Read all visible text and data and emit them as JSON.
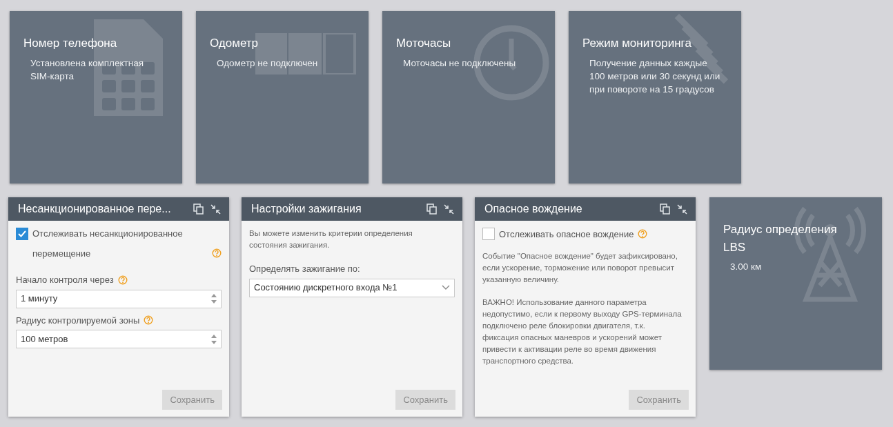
{
  "top_tiles": [
    {
      "kind": "sim",
      "title": "Номер телефона",
      "text": "Установлена комплектная SIM-карта"
    },
    {
      "kind": "odometer",
      "title": "Одометр",
      "text": "Одометр не подключен"
    },
    {
      "kind": "clock",
      "title": "Моточасы",
      "text": "Моточасы не подключены"
    },
    {
      "kind": "signal",
      "title": "Режим мониторинга",
      "text": "Получение данных каждые 100 метров или 30 секунд или при повороте на 15 градусов"
    }
  ],
  "panels": [
    {
      "title": "Несанкционированное пере...",
      "items": [
        {
          "kind": "checkbox",
          "label": "Отслеживать несанкционированное перемещение",
          "checked": true,
          "help": true
        },
        {
          "kind": "number_field",
          "label": "Начало контроля через",
          "value": "1  минуту",
          "help": true
        },
        {
          "kind": "number_field",
          "label": "Радиус контролируемой зоны",
          "value": "100  метров",
          "help": true
        }
      ],
      "button": {
        "label": "Сохранить",
        "disabled": true
      }
    },
    {
      "title": "Настройки зажигания",
      "items": [
        {
          "kind": "note",
          "text": "Вы можете изменить критерии определения состояния зажигания."
        },
        {
          "kind": "select",
          "label": "Определять зажигание по:",
          "value": "Состоянию дискретного входа №1",
          "help": false
        }
      ],
      "button": {
        "label": "Сохранить",
        "disabled": true
      }
    },
    {
      "title": "Опасное вождение",
      "items": [
        {
          "kind": "checkbox",
          "label": "Отслеживать опасное вождение",
          "checked": false,
          "help": true
        },
        {
          "kind": "note",
          "text": "Событие \"Опасное вождение\" будет зафиксировано, если ускорение, торможение или поворот превысит указанную величину."
        },
        {
          "kind": "note",
          "text": "ВАЖНО! Использование данного параметра недопустимо, если к первому выходу GPS-терминала подключено реле блокировки двигателя, т.к. фиксация опасных маневров и ускорений может привести к активации реле во время движения транспортного средства."
        }
      ],
      "button": {
        "label": "Сохранить",
        "disabled": true
      }
    }
  ],
  "lbs_tile": {
    "kind": "tower",
    "title": "Радиус определения LBS",
    "text": "3.00 км"
  }
}
